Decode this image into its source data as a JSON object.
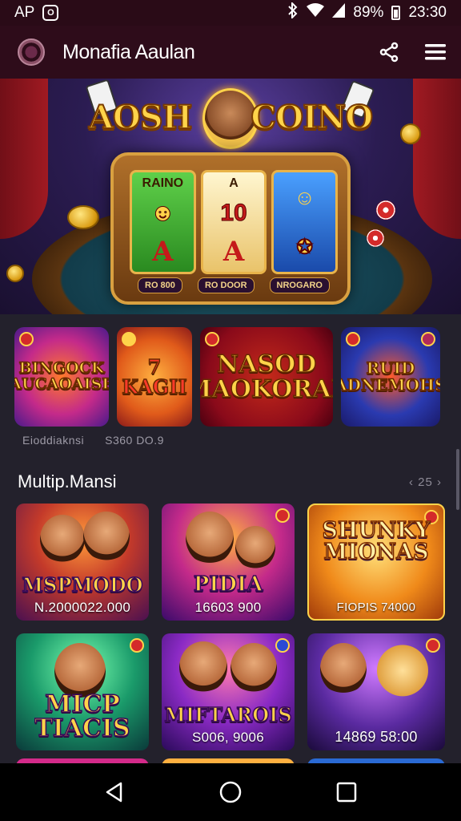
{
  "status_bar": {
    "carrier": "AP",
    "app_icon_glyph": "O",
    "battery": "89%",
    "time": "23:30",
    "icons": [
      "bluetooth-icon",
      "wifi-icon",
      "signal-icon",
      "battery-icon"
    ]
  },
  "app_bar": {
    "title": "Monafia Aaulan",
    "actions": [
      "share-icon",
      "menu-icon"
    ]
  },
  "hero": {
    "title_left": "AOSH",
    "title_right": "COINO",
    "reels": [
      {
        "top": "RAINO",
        "mid": "",
        "bot": "A"
      },
      {
        "top": "A",
        "mid": "10",
        "bot": "A"
      },
      {
        "top": "",
        "mid": "",
        "bot": ""
      }
    ],
    "buttons": [
      "RO 800",
      "RO DOOR",
      "NROGARO"
    ]
  },
  "featured": {
    "tiles": [
      {
        "title": "BINGOCK AUCAOAISE"
      },
      {
        "title": "7 KAGII"
      },
      {
        "title": "NASOD MAOKORAL"
      },
      {
        "title": "RUID PADNEMOHSS"
      }
    ],
    "captions": [
      "Eioddiaknsi",
      "S360 DO.9"
    ]
  },
  "section": {
    "title": "Multip.Mansi",
    "pager": "‹ 25 ›"
  },
  "games": [
    {
      "name": "MSPMODO",
      "prize": "N.2000022.000"
    },
    {
      "name": "PIDIA",
      "prize": "16603 900"
    },
    {
      "name": "SHUNKY MIONAS",
      "prize": "FIOPIS 74000"
    },
    {
      "name": "MICP TIACIS",
      "prize": ""
    },
    {
      "name": "MIFTAROIS",
      "prize": "S006, 9006"
    },
    {
      "name": "",
      "prize": "14869 58:00"
    }
  ],
  "nav_bar": {
    "buttons": [
      "back-icon",
      "home-icon",
      "recents-icon"
    ]
  },
  "colors": {
    "status_bg": "#2a0b17",
    "app_bar_bg": "#2e0c1a",
    "page_bg": "#23212c",
    "gold": "#ffd34a"
  }
}
